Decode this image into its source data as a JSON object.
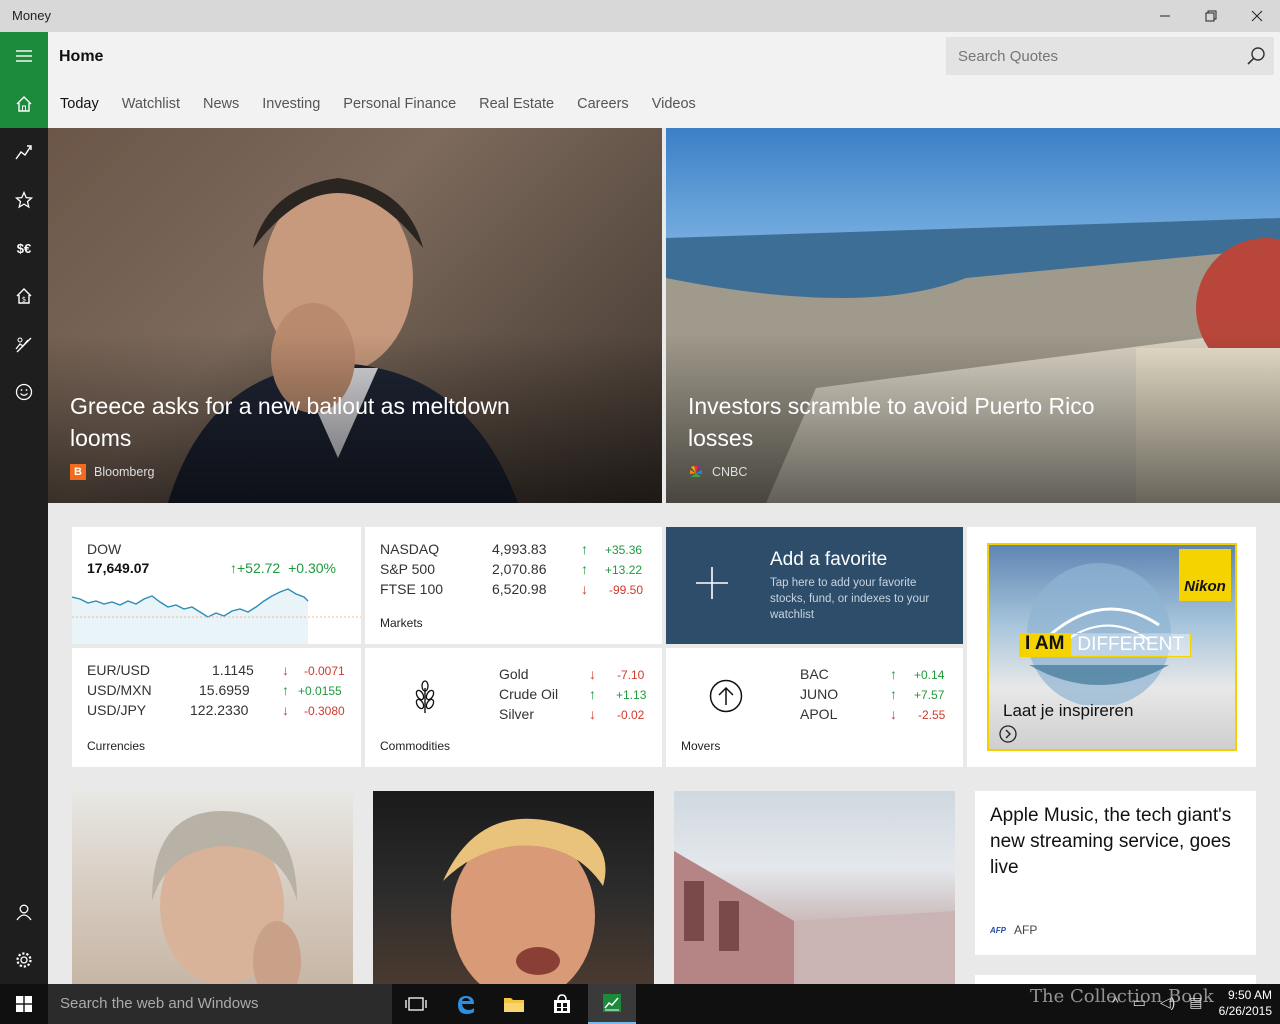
{
  "window": {
    "title": "Money"
  },
  "header": {
    "page_title": "Home",
    "search_placeholder": "Search Quotes",
    "tabs": [
      "Today",
      "Watchlist",
      "News",
      "Investing",
      "Personal Finance",
      "Real Estate",
      "Careers",
      "Videos"
    ],
    "active_tab": "Today"
  },
  "rail": {
    "items": [
      "home-icon",
      "trend-icon",
      "star-icon",
      "currency-icon",
      "house-dollar-icon",
      "chart-pen-icon",
      "smiley-icon",
      "person-icon",
      "gear-icon"
    ],
    "currency_label": "$€"
  },
  "hero": [
    {
      "title": "Greece asks for a new bailout as meltdown looms",
      "source": "Bloomberg",
      "logo_letter": "B",
      "logo_color": "#f26b1d"
    },
    {
      "title": "Investors scramble to avoid Puerto Rico losses",
      "source": "CNBC",
      "logo_letter": "",
      "logo_color": "#ffffff"
    }
  ],
  "dow": {
    "name": "DOW",
    "value": "17,649.07",
    "change": "+52.72",
    "percent": "+0.30%"
  },
  "markets": {
    "caption": "Markets",
    "rows": [
      {
        "name": "NASDAQ",
        "value": "4,993.83",
        "change": "+35.36",
        "dir": "up"
      },
      {
        "name": "S&P 500",
        "value": "2,070.86",
        "change": "+13.22",
        "dir": "up"
      },
      {
        "name": "FTSE 100",
        "value": "6,520.98",
        "change": "-99.50",
        "dir": "down"
      }
    ]
  },
  "add_favorite": {
    "title": "Add a favorite",
    "description": "Tap here to add your favorite stocks, fund, or indexes to your watchlist"
  },
  "currencies": {
    "caption": "Currencies",
    "rows": [
      {
        "name": "EUR/USD",
        "value": "1.1145",
        "change": "-0.0071",
        "dir": "down"
      },
      {
        "name": "USD/MXN",
        "value": "15.6959",
        "change": "+0.0155",
        "dir": "up"
      },
      {
        "name": "USD/JPY",
        "value": "122.2330",
        "change": "-0.3080",
        "dir": "down"
      }
    ]
  },
  "commodities": {
    "caption": "Commodities",
    "rows": [
      {
        "name": "Gold",
        "change": "-7.10",
        "dir": "down"
      },
      {
        "name": "Crude Oil",
        "change": "+1.13",
        "dir": "up"
      },
      {
        "name": "Silver",
        "change": "-0.02",
        "dir": "down"
      }
    ]
  },
  "movers": {
    "caption": "Movers",
    "rows": [
      {
        "name": "BAC",
        "change": "+0.14",
        "dir": "up"
      },
      {
        "name": "JUNO",
        "change": "+7.57",
        "dir": "up"
      },
      {
        "name": "APOL",
        "change": "-2.55",
        "dir": "down"
      }
    ]
  },
  "ad": {
    "brand": "Nikon",
    "banner_a": "I AM",
    "banner_b": "DIFFERENT",
    "tagline": "Laat je inspireren"
  },
  "news_card": {
    "title": "Apple Music, the tech giant's new streaming service, goes live",
    "source": "AFP",
    "logo": "AFP"
  },
  "taskbar": {
    "search_placeholder": "Search the web and Windows",
    "time": "9:50 AM",
    "date": "6/26/2015",
    "watermark": "The Collection Book"
  }
}
